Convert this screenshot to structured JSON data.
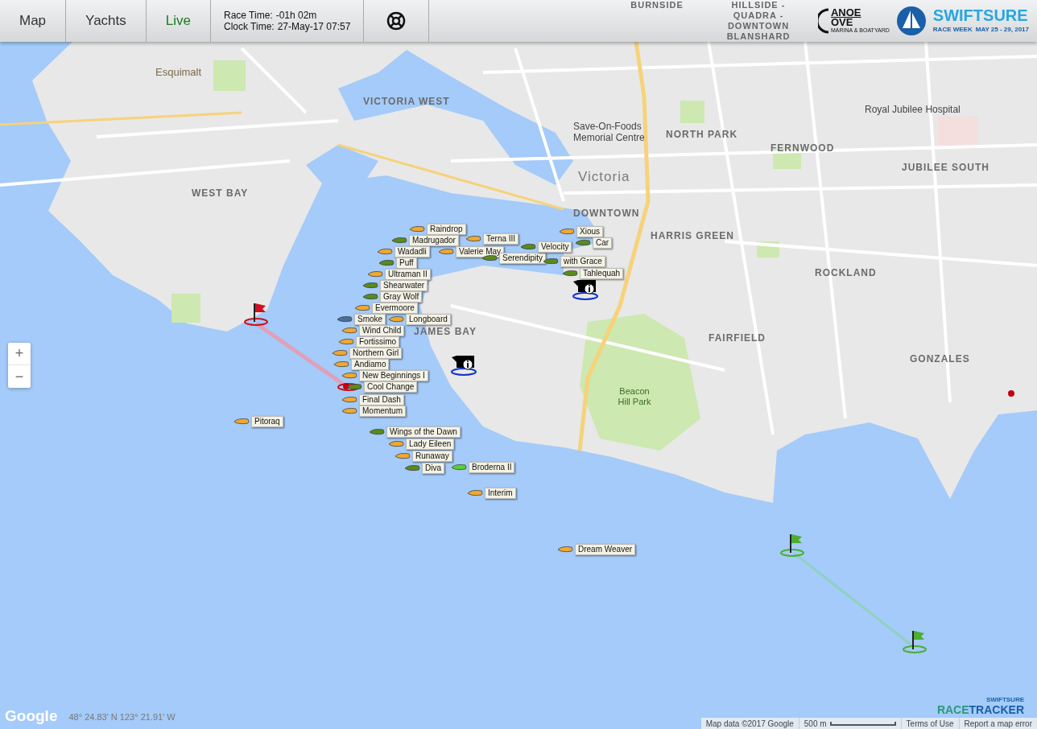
{
  "header": {
    "tabs": [
      {
        "label": "Map",
        "selected": false
      },
      {
        "label": "Yachts",
        "selected": false
      },
      {
        "label": "Live",
        "selected": true
      }
    ],
    "race_time": {
      "label": "Race Time:",
      "value": "-01h 02m"
    },
    "clock_time": {
      "label": "Clock Time:",
      "value": "27-May-17 07:57"
    },
    "sponsor_logo": {
      "line_1": "ANOE",
      "line_2": "OVE",
      "line_3": "MARINA & BOATYARD"
    },
    "event_logo": {
      "name": "SWIFTSURE",
      "subtitle": "RACE WEEK",
      "dates": "MAY 25 - 29, 2017"
    }
  },
  "map": {
    "places": [
      {
        "text": "BURNSIDE",
        "kind": "district"
      },
      {
        "text": "HILLSIDE - QUADRA - DOWNTOWN BLANSHARD",
        "kind": "district"
      },
      {
        "text": "Esquimalt",
        "kind": "city"
      },
      {
        "text": "VICTORIA WEST",
        "kind": "district"
      },
      {
        "text": "Save-On-Foods Memorial Centre",
        "kind": "poi"
      },
      {
        "text": "NORTH PARK",
        "kind": "district"
      },
      {
        "text": "Royal Jubilee Hospital",
        "kind": "hospital"
      },
      {
        "text": "FERNWOOD",
        "kind": "district"
      },
      {
        "text": "Victoria",
        "kind": "big_city"
      },
      {
        "text": "JUBILEE SOUTH",
        "kind": "district"
      },
      {
        "text": "WEST BAY",
        "kind": "district"
      },
      {
        "text": "DOWNTOWN",
        "kind": "district"
      },
      {
        "text": "HARRIS GREEN",
        "kind": "district"
      },
      {
        "text": "ROCKLAND",
        "kind": "district"
      },
      {
        "text": "JAMES BAY",
        "kind": "district"
      },
      {
        "text": "FAIRFIELD",
        "kind": "district"
      },
      {
        "text": "GONZALES",
        "kind": "district"
      },
      {
        "text": "Beacon Hill Park",
        "kind": "park"
      }
    ],
    "boats": [
      {
        "name": "Raindrop",
        "color": "#f0a830"
      },
      {
        "name": "Madrugador",
        "color": "#5a8a1c"
      },
      {
        "name": "Wadadli",
        "color": "#f0a830"
      },
      {
        "name": "Puff",
        "color": "#5a8a1c"
      },
      {
        "name": "Terna III",
        "color": "#f0a830"
      },
      {
        "name": "Valerie May",
        "color": "#f0a830"
      },
      {
        "name": "Serendipity",
        "color": "#5a8a1c"
      },
      {
        "name": "Xious",
        "color": "#f0a830"
      },
      {
        "name": "Car",
        "color": "#5a8a1c"
      },
      {
        "name": "Velocity",
        "color": "#5a8a1c"
      },
      {
        "name": "with Grace",
        "color": "#5a8a1c"
      },
      {
        "name": "Tahlequah",
        "color": "#5a8a1c"
      },
      {
        "name": "Ultraman II",
        "color": "#f0a830"
      },
      {
        "name": "Shearwater",
        "color": "#5a8a1c"
      },
      {
        "name": "Gray Wolf",
        "color": "#5a8a1c"
      },
      {
        "name": "Evermoore",
        "color": "#f0a830"
      },
      {
        "name": "Smoke",
        "color": "#4a6e9a"
      },
      {
        "name": "Longboard",
        "color": "#f0a830"
      },
      {
        "name": "Wind Child",
        "color": "#f0a830"
      },
      {
        "name": "Fortissimo",
        "color": "#f0a830"
      },
      {
        "name": "Northern Girl",
        "color": "#f0a830"
      },
      {
        "name": "Andiamo",
        "color": "#f0a830"
      },
      {
        "name": "New Beginnings I",
        "color": "#f0a830"
      },
      {
        "name": "Cool Change",
        "color": "#5a8a1c"
      },
      {
        "name": "Final Dash",
        "color": "#f0a830"
      },
      {
        "name": "Momentum",
        "color": "#f0a830"
      },
      {
        "name": "Pitoraq",
        "color": "#f0a830"
      },
      {
        "name": "Wings of the Dawn",
        "color": "#5a8a1c"
      },
      {
        "name": "Lady Eileen",
        "color": "#f0a830"
      },
      {
        "name": "Runaway",
        "color": "#f0a830"
      },
      {
        "name": "Diva",
        "color": "#5a8a1c"
      },
      {
        "name": "Broderna II",
        "color": "#5cd030"
      },
      {
        "name": "Interim",
        "color": "#f0a830"
      },
      {
        "name": "Dream Weaver",
        "color": "#f0a830"
      }
    ],
    "zoom_in": "+",
    "zoom_out": "−",
    "coordinates": "48° 24.83' N 123° 21.91' W",
    "google_logo": "Google",
    "tracker_logo": {
      "line_1": "SWIFTSURE",
      "line_2a": "RACE",
      "line_2b": "TRACKER"
    },
    "attribution": {
      "map_data": "Map data ©2017 Google",
      "scale": "500 m",
      "terms": "Terms of Use",
      "report": "Report a map error"
    }
  }
}
